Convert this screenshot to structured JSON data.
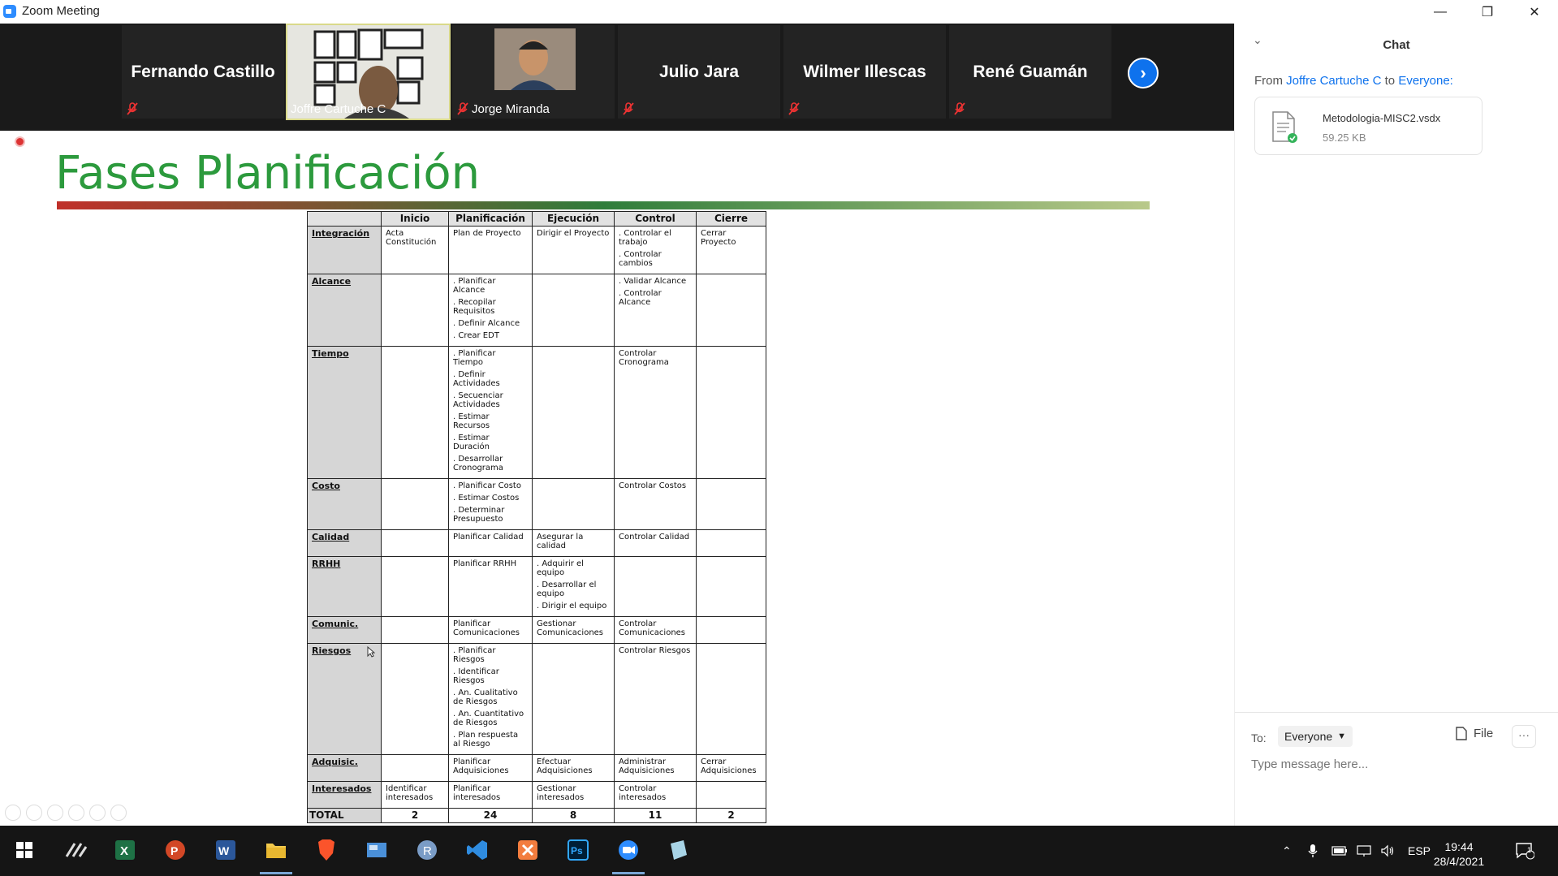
{
  "window": {
    "title": "Zoom Meeting"
  },
  "participants": [
    {
      "name": "Fernando Castillo",
      "muted": true,
      "video": false
    },
    {
      "name": "Joffre Cartuche C",
      "muted": false,
      "video": true,
      "active": true
    },
    {
      "name": "Jorge Miranda",
      "muted": true,
      "video": true
    },
    {
      "name": "Julio Jara",
      "muted": true,
      "video": false
    },
    {
      "name": "Wilmer Illescas",
      "muted": true,
      "video": false
    },
    {
      "name": "René Guamán",
      "muted": true,
      "video": false
    }
  ],
  "slide": {
    "title": "Fases Planificación",
    "table": {
      "headers": [
        "",
        "Inicio",
        "Planificación",
        "Ejecución",
        "Control",
        "Cierre"
      ],
      "rows": [
        {
          "area": "Integración",
          "cells": [
            [
              "Acta Constitución"
            ],
            [
              "Plan de Proyecto"
            ],
            [
              "Dirigir el Proyecto"
            ],
            [
              ". Controlar el trabajo",
              ". Controlar cambios"
            ],
            [
              "Cerrar Proyecto"
            ]
          ]
        },
        {
          "area": "Alcance",
          "cells": [
            [],
            [
              ". Planificar Alcance",
              ". Recopilar Requisitos",
              ". Definir Alcance",
              ". Crear EDT"
            ],
            [],
            [
              ". Validar Alcance",
              ". Controlar Alcance"
            ],
            []
          ]
        },
        {
          "area": "Tiempo",
          "cells": [
            [],
            [
              ". Planificar Tiempo",
              ". Definir Actividades",
              ". Secuenciar Actividades",
              ". Estimar Recursos",
              ". Estimar Duración",
              ". Desarrollar Cronograma"
            ],
            [],
            [
              "Controlar Cronograma"
            ],
            []
          ]
        },
        {
          "area": "Costo",
          "cells": [
            [],
            [
              ". Planificar Costo",
              ". Estimar Costos",
              ". Determinar Presupuesto"
            ],
            [],
            [
              "Controlar Costos"
            ],
            []
          ]
        },
        {
          "area": "Calidad",
          "cells": [
            [],
            [
              "Planificar Calidad"
            ],
            [
              "Asegurar la calidad"
            ],
            [
              "Controlar Calidad"
            ],
            []
          ]
        },
        {
          "area": "RRHH",
          "cells": [
            [],
            [
              "Planificar RRHH"
            ],
            [
              ". Adquirir el equipo",
              ". Desarrollar el equipo",
              ". Dirigir el equipo"
            ],
            [],
            []
          ]
        },
        {
          "area": "Comunic.",
          "cells": [
            [],
            [
              "Planificar Comunicaciones"
            ],
            [
              "Gestionar Comunicaciones"
            ],
            [
              "Controlar Comunicaciones"
            ],
            []
          ]
        },
        {
          "area": "Riesgos",
          "cells": [
            [],
            [
              ". Planificar Riesgos",
              ". Identificar Riesgos",
              ". An. Cualitativo de Riesgos",
              ". An. Cuantitativo de Riesgos",
              ". Plan respuesta al Riesgo"
            ],
            [],
            [
              "Controlar Riesgos"
            ],
            []
          ]
        },
        {
          "area": "Adquisic.",
          "cells": [
            [],
            [
              "Planificar Adquisiciones"
            ],
            [
              "Efectuar Adquisiciones"
            ],
            [
              "Administrar Adquisiciones"
            ],
            [
              "Cerrar Adquisiciones"
            ]
          ]
        },
        {
          "area": "Interesados",
          "cells": [
            [
              "Identificar interesados"
            ],
            [
              "Planificar interesados"
            ],
            [
              "Gestionar interesados"
            ],
            [
              "Controlar interesados"
            ],
            []
          ]
        }
      ],
      "total": {
        "label": "TOTAL",
        "values": [
          "2",
          "24",
          "8",
          "11",
          "2"
        ]
      }
    }
  },
  "chat": {
    "title": "Chat",
    "from_prefix": "From",
    "from_name": "Joffre Cartuche C",
    "to_word": "to",
    "to_name": "Everyone:",
    "file": {
      "name": "Metodologia-MISC2.vsdx",
      "size": "59.25 KB"
    },
    "to_label": "To:",
    "recipient": "Everyone",
    "file_button": "File",
    "more_button": "···",
    "input_placeholder": "Type message here..."
  },
  "taskbar": {
    "language": "ESP",
    "time": "19:44",
    "date": "28/4/2021",
    "notifications": "1"
  },
  "colors": {
    "zoom_blue": "#0e72ed",
    "slide_title_green": "#2c9a3d",
    "record_red": "#d33"
  }
}
